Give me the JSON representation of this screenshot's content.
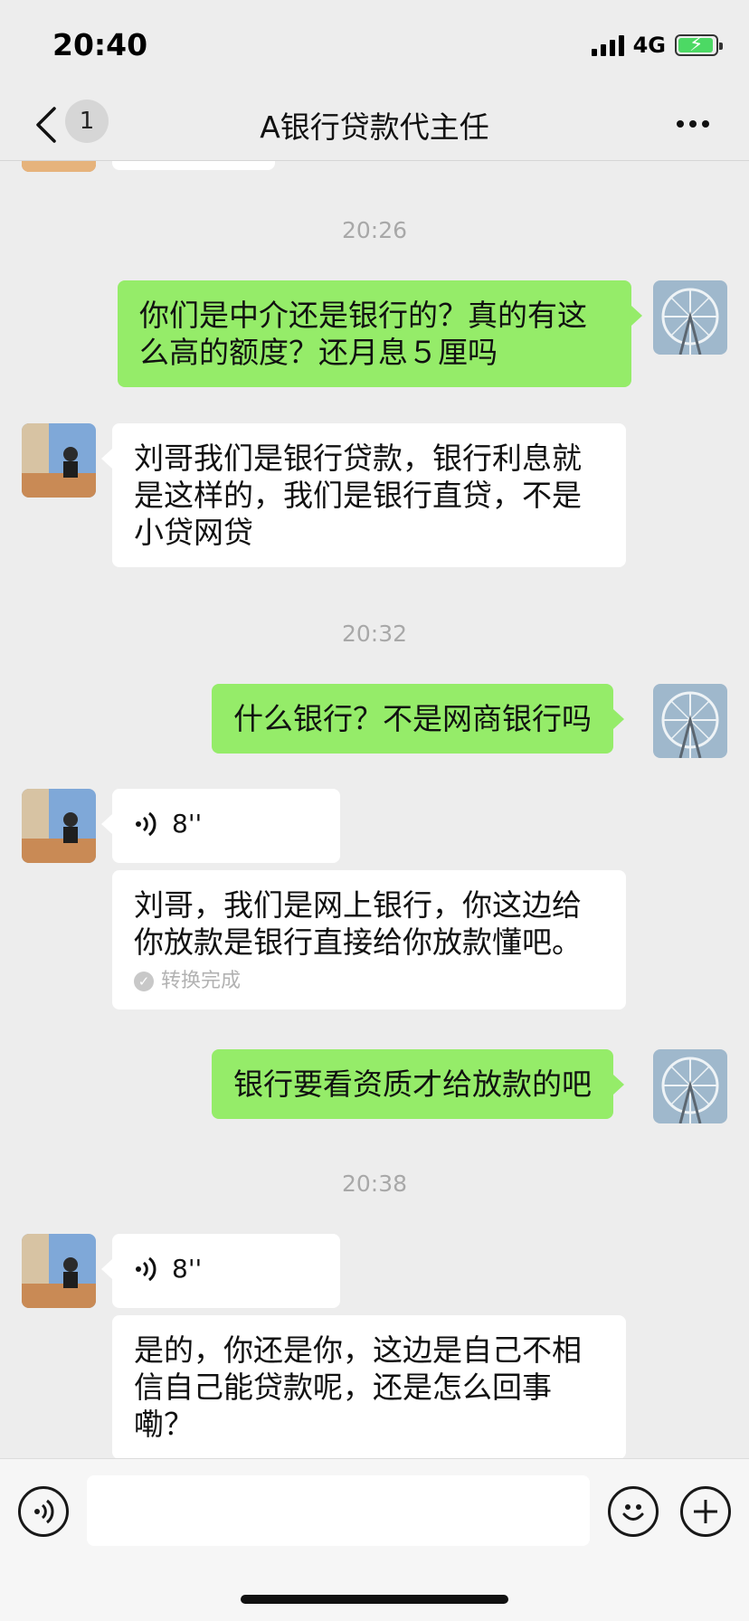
{
  "status_bar": {
    "time": "20:40",
    "network": "4G"
  },
  "nav": {
    "back_icon": "chevron-left-icon",
    "unread_count": "1",
    "title": "A银行贷款代主任",
    "more_icon": "more-dots-icon"
  },
  "messages": {
    "ts1": "20:26",
    "m1": "你们是中介还是银行的？真的有这么高的额度？还月息５厘吗",
    "m2": "刘哥我们是银行贷款，银行利息就是这样的，我们是银行直贷，不是小贷网贷",
    "ts2": "20:32",
    "m3": "什么银行？不是网商银行吗",
    "m4_voice_duration": "8''",
    "m4_transcript": "刘哥，我们是网上银行，你这边给你放款是银行直接给你放款懂吧。",
    "m4_status": "转换完成",
    "m5": "银行要看资质才给放款的吧",
    "ts3": "20:38",
    "m6_voice_duration": "8''",
    "m6_transcript": "是的，你还是你，这边是自己不相信自己能贷款呢，还是怎么回事嘞？"
  },
  "input_bar": {
    "voice_icon": "voice-input-icon",
    "emoji_icon": "emoji-icon",
    "plus_icon": "plus-icon",
    "text": ""
  },
  "colors": {
    "outgoing_bubble": "#95ec69",
    "incoming_bubble": "#ffffff",
    "background": "#ededed"
  }
}
